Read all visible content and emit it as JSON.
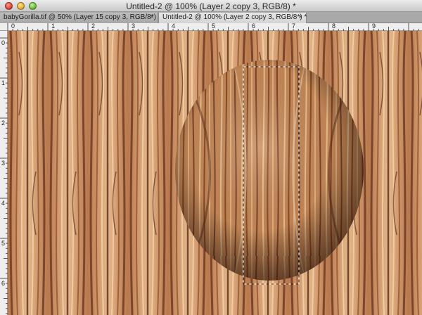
{
  "window": {
    "title": "Untitled-2 @ 100% (Layer 2 copy 3, RGB/8) *"
  },
  "tabs": [
    {
      "label": "babyGorilla.tif @ 50% (Layer 15 copy 3, RGB/8*) *",
      "close": "×",
      "active": false
    },
    {
      "label": "Untitled-2 @ 100% (Layer 2 copy 3, RGB/8*) *",
      "close": "×",
      "active": true
    }
  ],
  "ruler": {
    "horizontal": [
      "0",
      "1",
      "2",
      "3",
      "4",
      "5",
      "6",
      "7",
      "8",
      "9"
    ],
    "vertical": [
      "0",
      "1",
      "2",
      "3",
      "4",
      "5",
      "6"
    ]
  },
  "colors": {
    "wood_light": "#e6b98c",
    "wood_mid": "#b8794c",
    "wood_dark": "#6a3420",
    "sphere_highlight": "#d99a68",
    "sphere_shadow": "#5a2c18"
  }
}
